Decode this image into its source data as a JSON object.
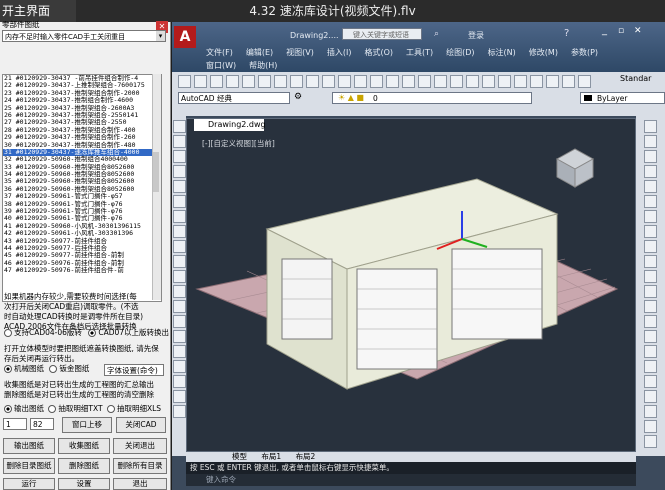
{
  "player": {
    "back_label": "开主界面",
    "video_title": "4.32 速冻库设计(视频文件).flv"
  },
  "left_panel": {
    "title": "零部件图纸",
    "select_value": "内存不足时输入零件CAD手工关闭重目",
    "list_items": [
      "21  #0120929-30437 -前吊挂件组合制作-4",
      "22  #0120929-30437-上推制架组合-7600175",
      "23  #0120929-30437-推制架组合制作-2000",
      "24  #0120929-30437-推制组合制作-4600",
      "25  #0120929-30437-推制架组合-2600A3",
      "26  #0120929-30437-推制架组合-2550141",
      "27  #0120929-30437-推制架组合-2550",
      "28  #0120929-30437-推制架组合制作-400",
      "29  #0120929-30437-推制架组合制作-260",
      "30  #0120929-30437-推制架组合制作-480",
      "31  #0120929-30437-速冻库推车组合-4000",
      "32  #0120929-50960-推制组合4000400",
      "33  #0120929-50960-推制架组合8052600",
      "34  #0120929-50960-推制架组合8052600",
      "35  #0120929-50960-推制架组合8052600",
      "36  #0120929-50960-推制架组合8052600",
      "37  #0120929-50961-管式门搁件-φ57",
      "38  #0120929-50961-管式门搁件-φ76",
      "39  #0120929-50961-管式门搁件-φ76",
      "40  #0120929-50961-管式门搁件-φ76",
      "41  #0120929-50960-小风机-30301396115",
      "42  #0120929-50961-小风机-303301396",
      "43  #0120929-50977-前挂件组合",
      "44  #0120929-50977-后挂件组合",
      "45  #0120929-50977-前挂件组合-前制",
      "46  #0120929-50976-前挂件组合-前制",
      "47  #0120929-50976-前挂件组合件-前"
    ],
    "selected_index": 10,
    "note_lines": [
      "如果机器内存较少,需要较费时间选择(每",
      "次打开后关闭CAD重启)调取零件。(不选",
      "时自动处理CAD转换时是调零件所在目录)",
      "ACAD 2006文件在备档后选择批量转换"
    ],
    "radio_version_a": "支持CAD04-06版转",
    "radio_version_b": "CAD07以上版转换出",
    "note2_lines": [
      "打开立体模型时要把图纸遮盖转换图纸, 请先保",
      "存后关闭再运行转出。"
    ],
    "radio_mech": "机械图纸",
    "radio_sheet": "钣金图纸",
    "setting_select": "字体设置(命令)",
    "note3_lines": [
      "收集图纸是对已转出生成的工程图的汇总输出",
      "删除图纸是对已转出生成的工程图的清空删除"
    ],
    "radio_out_dwg": "输出图纸",
    "radio_extract_txt": "抽取明细TXT",
    "radio_extract_xls": "抽取明细XLS",
    "page_from": "1",
    "page_to": "82",
    "btn_window_top": "窗口上移",
    "btn_close_cad": "关闭CAD",
    "btn_export": "输出图纸",
    "btn_collect": "收集图纸",
    "btn_close_exit": "关闭退出",
    "btn_delete_dir": "删除目录图纸",
    "btn_delete_drawing": "删除图纸",
    "btn_delete_all": "删除所有目录",
    "btn_bottom_1": "运行",
    "btn_bottom_2": "设置",
    "btn_bottom_3": "退出"
  },
  "cad": {
    "logo_letter": "A",
    "doc_short": "Drawing2....",
    "search_placeholder": "键入关键字或短语",
    "login_label": "登录",
    "menus_row1": [
      "文件(F)",
      "编辑(E)",
      "视图(V)",
      "插入(I)",
      "格式(O)",
      "工具(T)",
      "绘图(D)",
      "标注(N)",
      "修改(M)",
      "参数(P)"
    ],
    "menus_row2": [
      "窗口(W)",
      "帮助(H)"
    ],
    "workspace": "AutoCAD 经典",
    "layer_value": "0",
    "bylayer": "ByLayer",
    "style_standard": "Standar",
    "doc_tab": "Drawing2.dwg",
    "viewport_label": "[-][自定义视图][当前]",
    "layout_tabs": [
      "模型",
      "布局1",
      "布局2"
    ],
    "command_line": "按 ESC 或 ENTER 键退出, 或者单击鼠标右键显示快捷菜单。",
    "command_input": "键入命令"
  },
  "colors": {
    "selection": "#3169c6",
    "cad_title": "#3a5578",
    "drawing_bg": "#28313d",
    "floor": "#c9a7ae",
    "structure": "#e6e8d2"
  }
}
